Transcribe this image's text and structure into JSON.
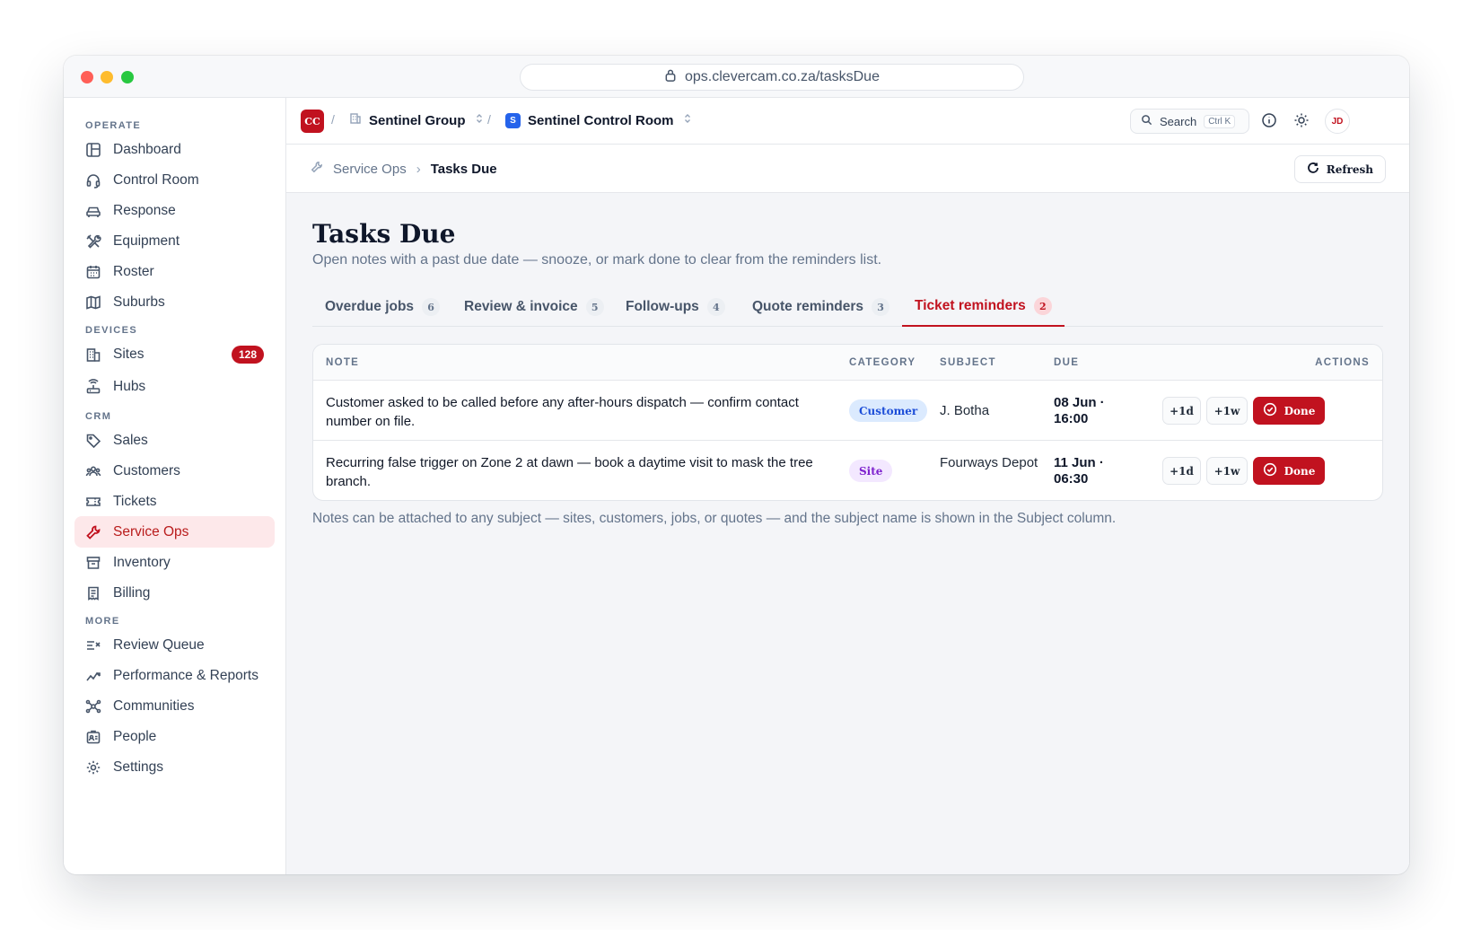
{
  "browser": {
    "url": "ops.clevercam.co.za/tasksDue"
  },
  "sidebar": {
    "sections": [
      "OPERATE",
      "DEVICES",
      "CRM",
      "MORE"
    ],
    "items": [
      {
        "label": "Dashboard",
        "icon": "dashboard-icon"
      },
      {
        "label": "Control Room",
        "icon": "headset-icon"
      },
      {
        "label": "Response",
        "icon": "car-icon"
      },
      {
        "label": "Equipment",
        "icon": "tools-icon"
      },
      {
        "label": "Roster",
        "icon": "calendar-icon"
      },
      {
        "label": "Suburbs",
        "icon": "map-icon"
      },
      {
        "label": "Sites",
        "icon": "building-icon",
        "badge": "128"
      },
      {
        "label": "Hubs",
        "icon": "router-icon"
      },
      {
        "label": "Sales",
        "icon": "tag-icon"
      },
      {
        "label": "Customers",
        "icon": "users-icon"
      },
      {
        "label": "Tickets",
        "icon": "ticket-icon"
      },
      {
        "label": "Service Ops",
        "icon": "wrench-icon",
        "active": true
      },
      {
        "label": "Inventory",
        "icon": "archive-icon"
      },
      {
        "label": "Billing",
        "icon": "receipt-icon"
      },
      {
        "label": "Review Queue",
        "icon": "list-check-icon"
      },
      {
        "label": "Performance & Reports",
        "icon": "trend-icon"
      },
      {
        "label": "Communities",
        "icon": "network-icon"
      },
      {
        "label": "People",
        "icon": "id-badge-icon"
      },
      {
        "label": "Settings",
        "icon": "gear-icon"
      }
    ]
  },
  "topbar": {
    "logo": "CC",
    "separator": "/",
    "org": "Sentinel Group",
    "workspace_badge": "S",
    "workspace": "Sentinel Control Room",
    "search_label": "Search",
    "search_shortcut": "Ctrl K",
    "avatar": "JD"
  },
  "breadcrumb": {
    "parent": "Service Ops",
    "current": "Tasks Due",
    "refresh_label": "Refresh"
  },
  "page": {
    "title": "Tasks Due",
    "subtitle": "Open notes with a past due date — snooze, or mark done to clear from the reminders list.",
    "footnote": "Notes can be attached to any subject — sites, customers, jobs, or quotes — and the subject name is shown in the Subject column."
  },
  "tabs": [
    {
      "label": "Overdue jobs",
      "count": "6"
    },
    {
      "label": "Review & invoice",
      "count": "5"
    },
    {
      "label": "Follow-ups",
      "count": "4"
    },
    {
      "label": "Quote reminders",
      "count": "3"
    },
    {
      "label": "Ticket reminders",
      "count": "2",
      "active": true
    }
  ],
  "table": {
    "headers": {
      "note": "NOTE",
      "category": "CATEGORY",
      "subject": "SUBJECT",
      "due": "DUE",
      "actions": "ACTIONS"
    },
    "rows": [
      {
        "note": "Customer asked to be called before any after-hours dispatch — confirm contact number on file.",
        "category": "Customer",
        "subject": "J. Botha",
        "due_date": "08 Jun ·",
        "due_time": "16:00"
      },
      {
        "note": "Recurring false trigger on Zone 2 at dawn — book a daytime visit to mask the tree branch.",
        "category": "Site",
        "subject": "Fourways Depot",
        "due_date": "11 Jun ·",
        "due_time": "06:30"
      }
    ],
    "actions": {
      "snooze_day": "+1d",
      "snooze_week": "+1w",
      "done": "Done"
    }
  },
  "colors": {
    "accent": "#c1121f",
    "active_bg": "#fde8ea",
    "link_blue": "#2563eb"
  }
}
